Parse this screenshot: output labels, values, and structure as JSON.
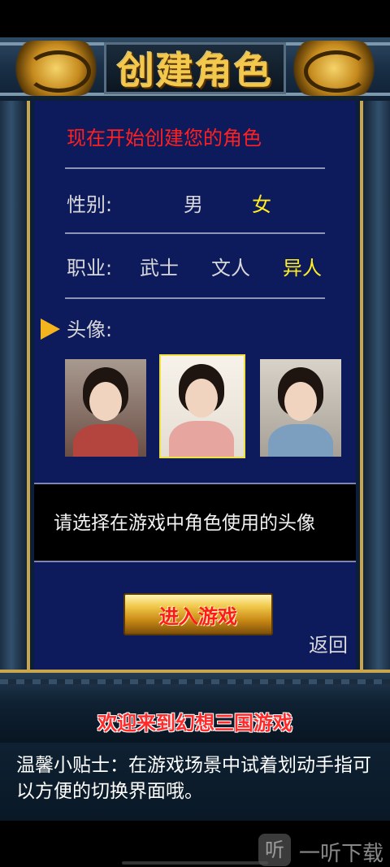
{
  "header": {
    "title": "创建角色"
  },
  "panel": {
    "heading": "现在开始创建您的角色",
    "gender": {
      "label": "性别:",
      "options": [
        "男",
        "女"
      ],
      "selected": "女"
    },
    "profession": {
      "label": "职业:",
      "options": [
        "武士",
        "文人",
        "异人"
      ],
      "selected": "异人"
    },
    "avatar": {
      "label": "头像:",
      "selected_index": 1
    },
    "message": "请选择在游戏中角色使用的头像",
    "enter_button": "进入游戏",
    "back_button": "返回"
  },
  "banner": {
    "welcome": "欢迎来到幻想三国游戏"
  },
  "tip": {
    "text": "温馨小贴士：在游戏场景中试着划动手指可以方便的切换界面哦。"
  },
  "watermark": {
    "text": "一听下载",
    "icon": "听"
  },
  "colors": {
    "heading": "#ff2020",
    "selected": "#ffee22",
    "panel": "#0d1a5c"
  }
}
